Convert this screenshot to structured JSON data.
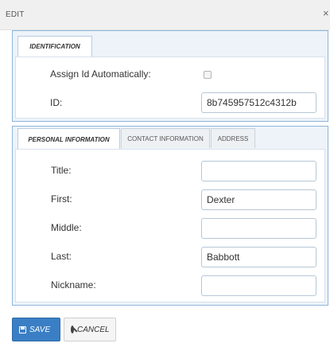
{
  "dialog": {
    "title": "EDIT",
    "close_glyph": "×"
  },
  "identification": {
    "tab_label": "IDENTIFICATION",
    "assign_label": "Assign Id Automatically:",
    "assign_checked": false,
    "id_label": "ID:",
    "id_value": "8b745957512c4312b"
  },
  "tabs": [
    "PERSONAL INFORMATION",
    "CONTACT INFORMATION",
    "ADDRESS"
  ],
  "personal": {
    "title_label": "Title:",
    "title_value": "",
    "first_label": "First:",
    "first_value": "Dexter",
    "middle_label": "Middle:",
    "middle_value": "",
    "last_label": "Last:",
    "last_value": "Babbott",
    "nickname_label": "Nickname:",
    "nickname_value": ""
  },
  "buttons": {
    "save_label": "SAVE",
    "cancel_label": "CANCEL"
  },
  "colors": {
    "accent": "#3a7fc5",
    "panel_border": "#8fb6d8",
    "panel_bg": "#edf3f9"
  },
  "icons": {
    "close": "close-icon",
    "save": "save-icon",
    "cancel": "cancel-icon"
  }
}
